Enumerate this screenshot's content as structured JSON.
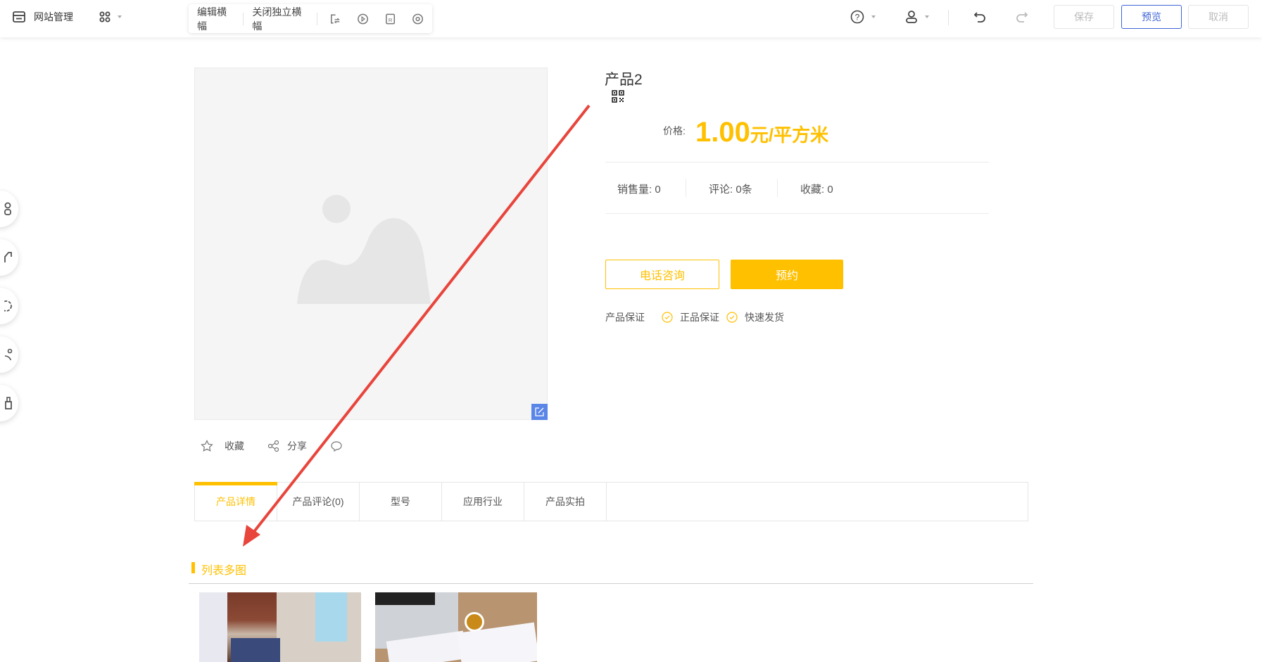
{
  "topbar": {
    "site_manage": "网站管理",
    "banner_toolbar": {
      "edit_banner": "编辑横幅",
      "close_banner": "关闭独立横幅"
    },
    "save": "保存",
    "preview": "预览",
    "cancel": "取消"
  },
  "product": {
    "title": "产品2",
    "price_label": "价格:",
    "price": "1.00",
    "unit": "元/平方米",
    "stats": [
      {
        "label": "销售量:",
        "value": "0"
      },
      {
        "label": "评论:",
        "value": "0条"
      },
      {
        "label": "收藏:",
        "value": "0"
      }
    ],
    "phone_button": "电话咨询",
    "book_button": "预约",
    "guarantee_label": "产品保证",
    "guarantees": [
      "正品保证",
      "快速发货"
    ],
    "actions": {
      "favorite": "收藏",
      "share": "分享"
    }
  },
  "tabs": [
    {
      "label": "产品详情",
      "active": true
    },
    {
      "label": "产品评论(0)"
    },
    {
      "label": "型号"
    },
    {
      "label": "应用行业"
    },
    {
      "label": "产品实拍"
    }
  ],
  "section": {
    "title": "列表多图"
  },
  "colors": {
    "accent": "#ffc000",
    "primary": "#3e64d6",
    "arrow": "#e8453c"
  }
}
